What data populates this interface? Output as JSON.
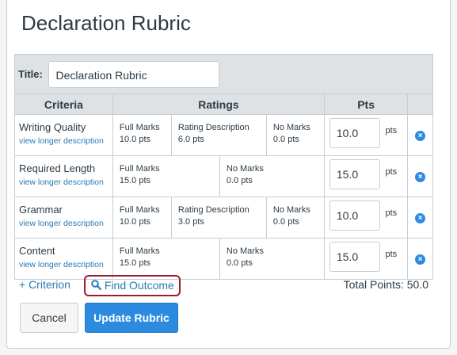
{
  "dialog": {
    "title": "Declaration Rubric"
  },
  "rubric": {
    "title_label": "Title:",
    "title_value": "Declaration Rubric",
    "headers": {
      "criteria": "Criteria",
      "ratings": "Ratings",
      "pts": "Pts"
    },
    "criteria": [
      {
        "name": "Writing Quality",
        "link": "view longer description",
        "ratings": [
          {
            "title": "Full Marks",
            "pts": "10.0 pts"
          },
          {
            "title": "Rating Description",
            "pts": "6.0 pts"
          },
          {
            "title": "No Marks",
            "pts": "0.0 pts"
          }
        ],
        "points": "10.0",
        "unit": "pts"
      },
      {
        "name": "Required Length",
        "link": "view longer description",
        "ratings": [
          {
            "title": "Full Marks",
            "pts": "15.0 pts"
          },
          {
            "title": "No Marks",
            "pts": "0.0 pts"
          }
        ],
        "points": "15.0",
        "unit": "pts"
      },
      {
        "name": "Grammar",
        "link": "view longer description",
        "ratings": [
          {
            "title": "Full Marks",
            "pts": "10.0 pts"
          },
          {
            "title": "Rating Description",
            "pts": "3.0 pts"
          },
          {
            "title": "No Marks",
            "pts": "0.0 pts"
          }
        ],
        "points": "10.0",
        "unit": "pts"
      },
      {
        "name": "Content",
        "link": "view longer description",
        "ratings": [
          {
            "title": "Full Marks",
            "pts": "15.0 pts"
          },
          {
            "title": "No Marks",
            "pts": "0.0 pts"
          }
        ],
        "points": "15.0",
        "unit": "pts"
      }
    ]
  },
  "footer": {
    "add_criterion": "+ Criterion",
    "find_outcome": "Find Outcome",
    "total_points": "Total Points: 50.0"
  },
  "buttons": {
    "cancel": "Cancel",
    "update": "Update Rubric"
  },
  "colors": {
    "accent": "#2d8ae1",
    "link": "#2a7ab5",
    "highlight": "#9a1d28"
  }
}
